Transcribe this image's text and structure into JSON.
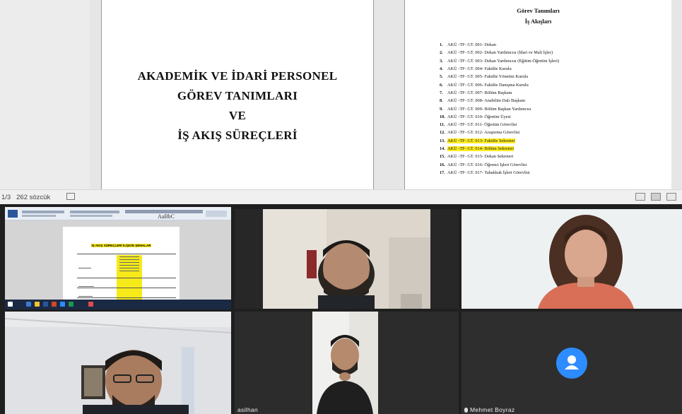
{
  "document": {
    "page1_title_lines": [
      "AKADEMİK VE İDARİ PERSONEL",
      "GÖREV TANIMLARI",
      "VE",
      "İŞ AKIŞ SÜREÇLERİ"
    ],
    "page2_heading": "Görev Tanımları",
    "page2_subheading": "İş Akışları",
    "items": [
      {
        "num": "1.",
        "text": "AKÜ -TF- GT. 001- Dekan",
        "highlight": false
      },
      {
        "num": "2.",
        "text": "AKÜ -TF- GT. 002- Dekan Yardımcısı (İdari ve Mali İşler)",
        "highlight": false
      },
      {
        "num": "3.",
        "text": "AKÜ -TF- GT. 003- Dekan Yardımcısı (Eğitim-Öğretim İşleri)",
        "highlight": false
      },
      {
        "num": "4.",
        "text": "AKÜ -TF- GT. 004- Fakülte Kurulu",
        "highlight": false
      },
      {
        "num": "5.",
        "text": "AKÜ -TF- GT. 005- Fakülte Yönetim Kurulu",
        "highlight": false
      },
      {
        "num": "6.",
        "text": "AKÜ -TF- GT. 006- Fakülte Danışma Kurulu",
        "highlight": false
      },
      {
        "num": "7.",
        "text": "AKÜ -TF- GT. 007- Bölüm Başkanı",
        "highlight": false
      },
      {
        "num": "8.",
        "text": "AKÜ -TF- GT. 008- Anabilim Dalı Başkanı",
        "highlight": false
      },
      {
        "num": "9.",
        "text": "AKÜ -TF- GT. 009- Bölüm Başkan Yardımcısı",
        "highlight": false
      },
      {
        "num": "10.",
        "text": "AKÜ -TF- GT. 010- Öğretim Üyesi",
        "highlight": false
      },
      {
        "num": "11.",
        "text": "AKÜ -TF- GT. 011- Öğretim Görevlisi",
        "highlight": false
      },
      {
        "num": "12.",
        "text": "AKÜ -TF- GT. 012- Araştırma Görevlisi",
        "highlight": false
      },
      {
        "num": "13.",
        "text": "AKÜ -TF- GT. 013- Fakülte Sekreteri",
        "highlight": true
      },
      {
        "num": "14.",
        "text": "AKÜ -TF- GT. 014- Bölüm Sekreteri",
        "highlight": true
      },
      {
        "num": "15.",
        "text": "AKÜ -TF- GT. 015- Dekan Sekreteri",
        "highlight": false
      },
      {
        "num": "16.",
        "text": "AKÜ -TF- GT. 016- Öğrenci İşleri Görevlisi",
        "highlight": false
      },
      {
        "num": "17.",
        "text": "AKÜ -TF- GT. 017- Tahakkuk İşleri Görevlisi",
        "highlight": false
      }
    ]
  },
  "status_bar": {
    "page_info": "1/3",
    "word_count": "262 sözcük"
  },
  "screen_share": {
    "doc_title": "İŞ AKIŞ SÜREÇLERİ İLİŞKİN ŞEMALAR"
  },
  "participants": [
    {
      "label": ""
    },
    {
      "label": ""
    },
    {
      "label": ""
    },
    {
      "label": ""
    },
    {
      "label": "asilhan"
    },
    {
      "label": "Mehmet Boyraz"
    }
  ],
  "colors": {
    "highlight": "#ffee22",
    "avatar": "#2d8cff",
    "tile_bg": "#2e2e2e"
  }
}
